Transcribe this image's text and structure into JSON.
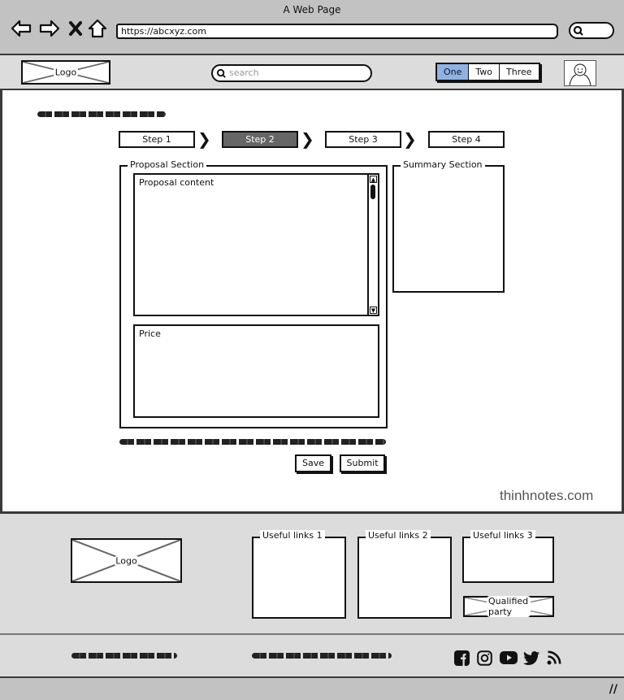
{
  "browser": {
    "title": "A Web Page",
    "url": "https://abcxyz.com",
    "nav_icons": [
      "back-arrow-icon",
      "forward-arrow-icon",
      "close-x-icon",
      "home-icon"
    ]
  },
  "header": {
    "logo_label": "Logo",
    "search_placeholder": "search",
    "tabs": [
      {
        "label": "One",
        "active": true
      },
      {
        "label": "Two",
        "active": false
      },
      {
        "label": "Three",
        "active": false
      }
    ],
    "active_tab_color": "#8fb2e6"
  },
  "main": {
    "steps": [
      {
        "label": "Step 1",
        "active": false
      },
      {
        "label": "Step 2",
        "active": true
      },
      {
        "label": "Step 3",
        "active": false
      },
      {
        "label": "Step 4",
        "active": false
      }
    ],
    "proposal_section": {
      "legend": "Proposal Section",
      "content_label": "Proposal content",
      "price_label": "Price"
    },
    "summary_section": {
      "legend": "Summary Section"
    },
    "buttons": {
      "save": "Save",
      "submit": "Submit"
    },
    "watermark": "thinhnotes.com"
  },
  "footer": {
    "logo_label": "Logo",
    "link_groups": [
      "Useful links 1",
      "Useful links 2",
      "Useful links 3"
    ],
    "qualified_label": "Qualified party",
    "social_icons": [
      "facebook-icon",
      "instagram-icon",
      "youtube-icon",
      "twitter-icon",
      "rss-icon"
    ]
  }
}
